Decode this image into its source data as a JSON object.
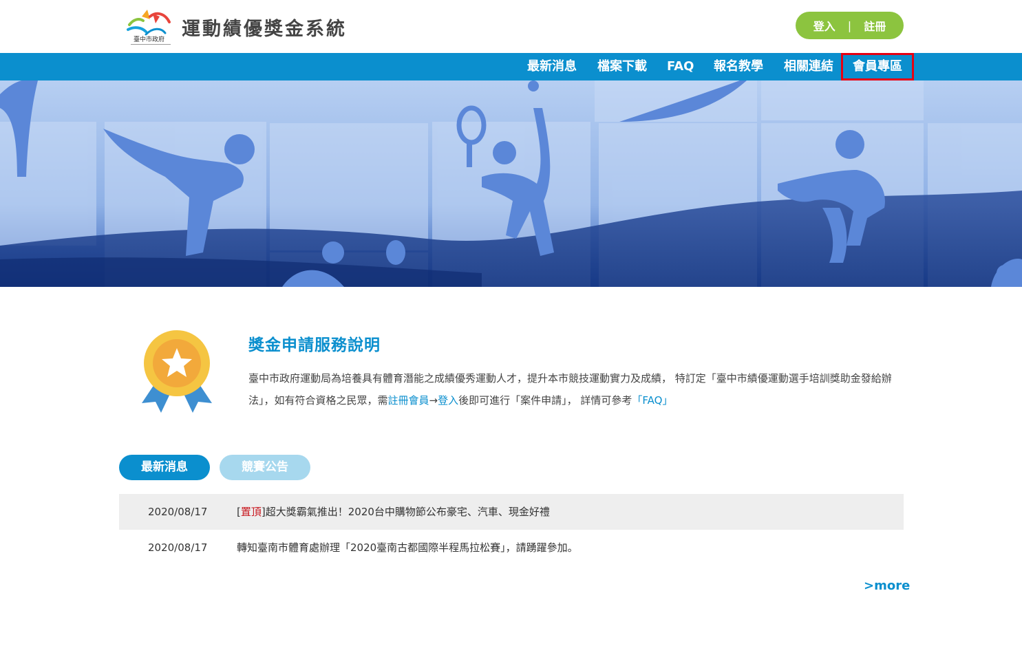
{
  "header": {
    "logo_caption": "臺中市政府",
    "site_title": "運動績優獎金系統",
    "login_label": "登入",
    "separator": "|",
    "register_label": "註冊"
  },
  "nav": {
    "items": [
      {
        "label": "最新消息"
      },
      {
        "label": "檔案下載"
      },
      {
        "label": "FAQ"
      },
      {
        "label": "報名教學"
      },
      {
        "label": "相關連結"
      },
      {
        "label": "會員專區"
      }
    ],
    "active_index": 5
  },
  "banner": {
    "slide_count": 2,
    "active_slide": 0
  },
  "intro": {
    "title": "獎金申請服務說明",
    "text_part1": "臺中市政府運動局為培養具有體育潛能之成績優秀運動人才，提升本市競技運動實力及成績， 特訂定「臺中市績優運動選手培訓獎助金發給辦法」，如有符合資格之民眾，需",
    "link_register": "註冊會員",
    "arrow": "→",
    "link_login": "登入",
    "text_part2": "後即可進行「案件申請」， 詳情可參考",
    "link_faq": "「FAQ」"
  },
  "tabs": {
    "news": "最新消息",
    "competition": "競賽公告"
  },
  "news": [
    {
      "date": "2020/08/17",
      "pin_open": "[",
      "pin_label": "置頂",
      "pin_close": "]",
      "title": "超大獎霸氣推出！2020台中購物節公布豪宅、汽車、現金好禮"
    },
    {
      "date": "2020/08/17",
      "title": "轉知臺南市體育處辦理「2020臺南古都國際半程馬拉松賽」，請踴躍參加。"
    }
  ],
  "more_label": ">more",
  "colors": {
    "primary": "#0b8fce",
    "auth_green": "#8cc43f",
    "active_outline": "#e60012",
    "pin_red": "#c8161d",
    "tab_inactive": "#a7d8ee"
  }
}
